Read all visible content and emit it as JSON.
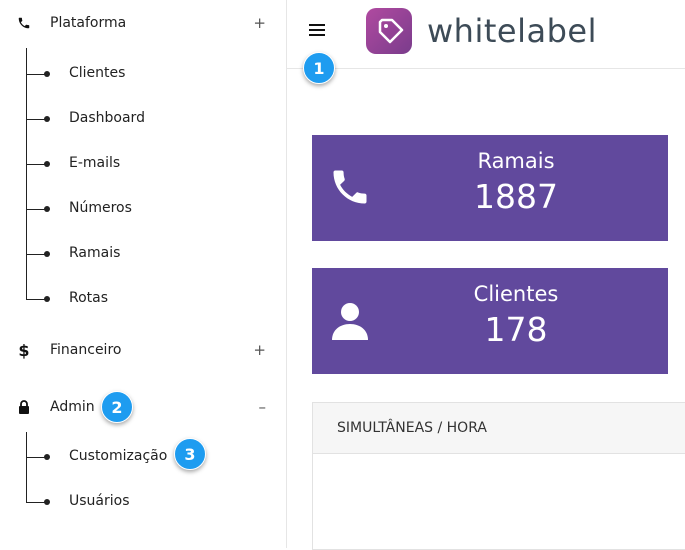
{
  "sidebar": {
    "sections": [
      {
        "label": "Plataforma",
        "icon": "phone-icon",
        "toggle": "+"
      },
      {
        "label": "Financeiro",
        "icon": "dollar-icon",
        "toggle": "+"
      },
      {
        "label": "Admin",
        "icon": "lock-icon",
        "toggle": "–"
      }
    ],
    "plataforma_items": [
      "Clientes",
      "Dashboard",
      "E-mails",
      "Números",
      "Ramais",
      "Rotas"
    ],
    "admin_items": [
      "Customização",
      "Usuários"
    ]
  },
  "topbar": {
    "menu_icon": "hamburger-icon",
    "logo_text": "whitelabel",
    "logo_icon": "tag-logo-icon"
  },
  "cards": [
    {
      "title": "Ramais",
      "value": "1887",
      "icon": "phone-icon"
    },
    {
      "title": "Clientes",
      "value": "178",
      "icon": "user-icon"
    }
  ],
  "panel": {
    "title": "SIMULTÂNEAS / HORA"
  },
  "markers": [
    "1",
    "2",
    "3"
  ],
  "colors": {
    "card_bg": "#61499d",
    "marker_bg": "#1e9cf0",
    "logo_text": "#3d4b57"
  }
}
